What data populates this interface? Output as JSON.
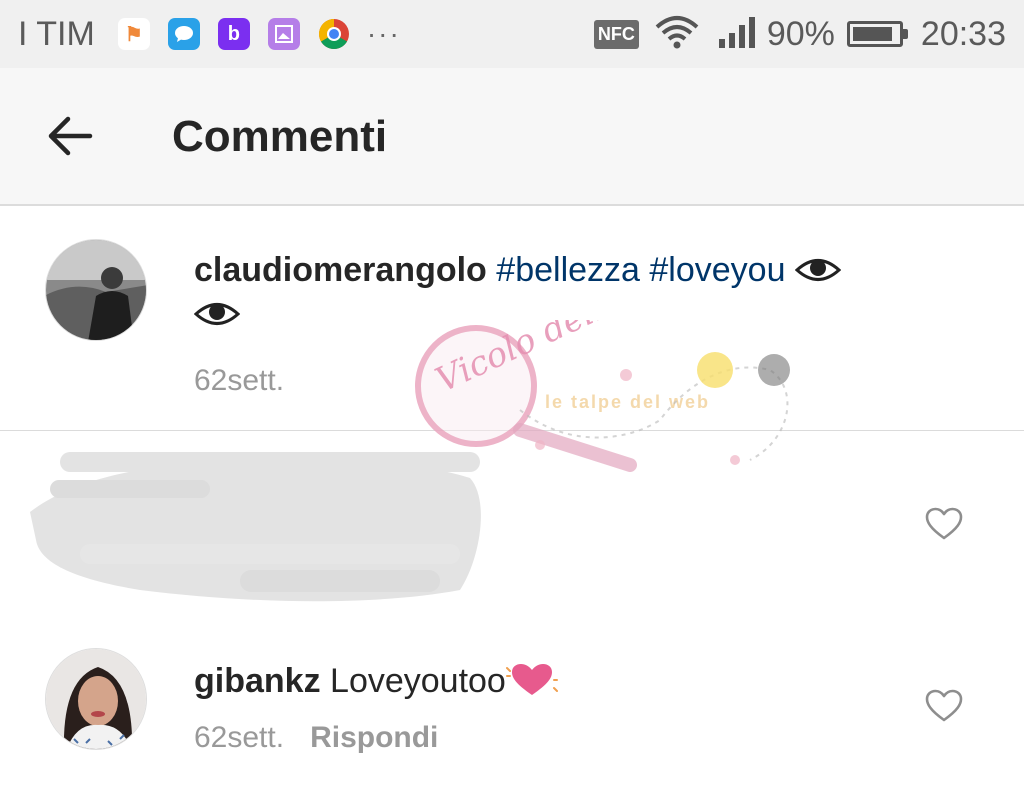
{
  "status_bar": {
    "carrier": "I TIM",
    "apps": [
      {
        "name": "flag-app-icon",
        "color": "#f0f0f0",
        "glyph": "⚑"
      },
      {
        "name": "message-app-icon",
        "color": "#2aa1e8",
        "glyph": "💬"
      },
      {
        "name": "b-app-icon",
        "color": "#7b2ff0",
        "glyph": "b"
      },
      {
        "name": "gallery-app-icon",
        "color": "#b57ee8",
        "glyph": "▣"
      },
      {
        "name": "chrome-icon",
        "color": "#ffffff",
        "glyph": ""
      }
    ],
    "more": "···",
    "nfc": "NFC",
    "battery": "90%",
    "battery_level": 0.9,
    "time": "20:33"
  },
  "header": {
    "title": "Commenti"
  },
  "comments": [
    {
      "username": "claudiomerangolo",
      "tags": [
        "#bellezza",
        "#loveyou"
      ],
      "time": "62sett."
    },
    {
      "username": "",
      "text": "",
      "redacted": true
    },
    {
      "username": "gibankz",
      "text": "Loveyoutoo",
      "time": "62sett.",
      "reply": "Rispondi"
    }
  ],
  "watermark": {
    "brand": "Vicolo delle News",
    "tagline": "le talpe del web"
  }
}
